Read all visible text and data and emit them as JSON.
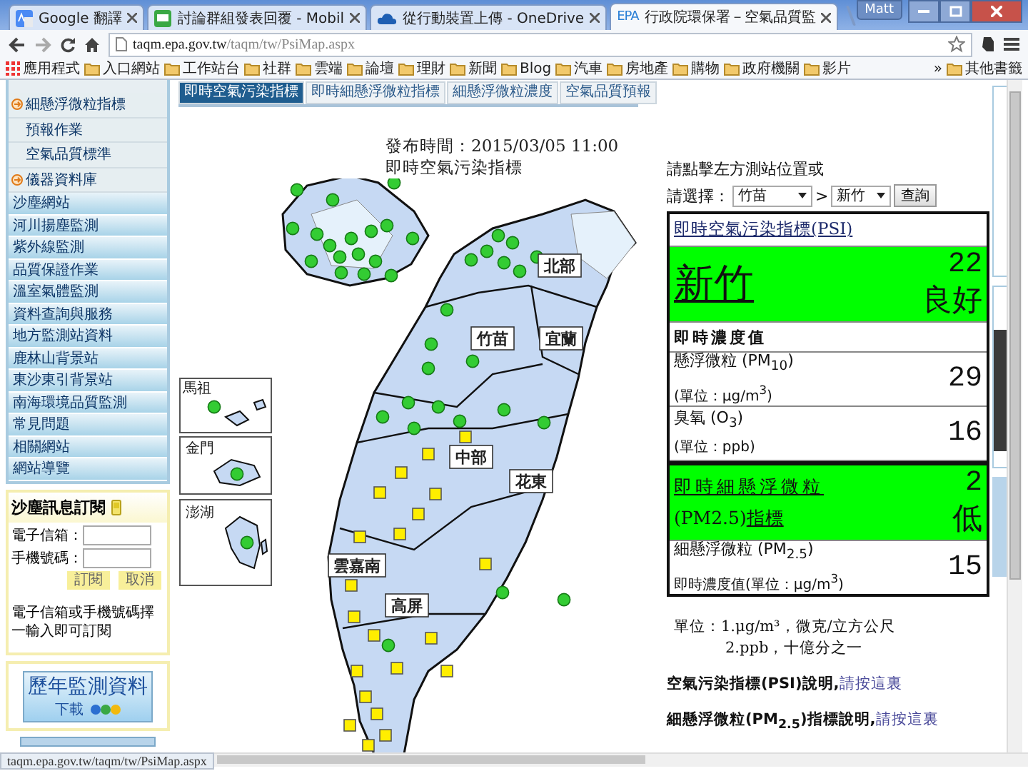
{
  "browser": {
    "tabs": [
      {
        "title": "Google 翻譯",
        "kind": "translate",
        "selected": false
      },
      {
        "title": "討論群組發表回覆 - Mobil",
        "kind": "group",
        "selected": false
      },
      {
        "title": "從行動裝置上傳 - OneDrive",
        "kind": "cloud",
        "selected": false
      },
      {
        "title": "行政院環保署－空氣品質監",
        "kind": "logo",
        "icon_text": "EPA",
        "selected": true
      }
    ],
    "user": "Matt",
    "url_host": "taqm.epa.gov.tw",
    "url_path": "/taqm/tw/PsiMap.aspx",
    "bookmarks": [
      {
        "label": "應用程式",
        "kind": "apps"
      },
      {
        "label": "入口網站",
        "kind": "folder"
      },
      {
        "label": "工作站台",
        "kind": "folder"
      },
      {
        "label": "社群",
        "kind": "folder"
      },
      {
        "label": "雲端",
        "kind": "folder"
      },
      {
        "label": "論壇",
        "kind": "folder"
      },
      {
        "label": "理財",
        "kind": "folder"
      },
      {
        "label": "新聞",
        "kind": "folder"
      },
      {
        "label": "Blog",
        "kind": "folder"
      },
      {
        "label": "汽車",
        "kind": "folder"
      },
      {
        "label": "房地產",
        "kind": "folder"
      },
      {
        "label": "購物",
        "kind": "folder"
      },
      {
        "label": "政府機關",
        "kind": "folder"
      },
      {
        "label": "影片",
        "kind": "folder"
      }
    ],
    "bookmarks_overflow": "»",
    "other_bookmarks": "其他書籤"
  },
  "sidebar": {
    "items": [
      {
        "label": "細懸浮微粒指標",
        "kind": "arrow"
      },
      {
        "label": "預報作業",
        "kind": "sub"
      },
      {
        "label": "空氣品質標準",
        "kind": "sub"
      },
      {
        "label": "儀器資料庫",
        "kind": "arrow"
      },
      {
        "label": "沙塵網站",
        "kind": "main"
      },
      {
        "label": "河川揚塵監測",
        "kind": "main"
      },
      {
        "label": "紫外線監測",
        "kind": "main"
      },
      {
        "label": "品質保證作業",
        "kind": "main"
      },
      {
        "label": "溫室氣體監測",
        "kind": "main"
      },
      {
        "label": "資料查詢與服務",
        "kind": "main"
      },
      {
        "label": "地方監測站資料",
        "kind": "main"
      },
      {
        "label": "鹿林山背景站",
        "kind": "main"
      },
      {
        "label": "東沙東引背景站",
        "kind": "main"
      },
      {
        "label": "南海環境品質監測",
        "kind": "main"
      },
      {
        "label": "常見問題",
        "kind": "main"
      },
      {
        "label": "相關網站",
        "kind": "main"
      },
      {
        "label": "網站導覽",
        "kind": "main"
      }
    ],
    "subscribe": {
      "title": "沙塵訊息訂閱",
      "email_label": "電子信箱：",
      "phone_label": "手機號碼：",
      "subscribe_button": "訂閱",
      "cancel_button": "取消",
      "note": "電子信箱或手機號碼擇一輸入即可訂閱"
    },
    "banner": {
      "title": "歷年監測資料",
      "subtitle": "下載"
    }
  },
  "tabs": [
    {
      "label": "即時空氣污染指標",
      "selected": true
    },
    {
      "label": "即時細懸浮微粒指標",
      "selected": false
    },
    {
      "label": "細懸浮微粒濃度",
      "selected": false
    },
    {
      "label": "空氣品質預報",
      "selected": false
    }
  ],
  "map": {
    "published": "發布時間：2015/03/05 11:00",
    "title": "即時空氣污染指標",
    "regions": [
      "北部",
      "竹苗",
      "宜蘭",
      "中部",
      "花東",
      "雲嘉南",
      "高屏"
    ],
    "insets": [
      "馬祖",
      "金門",
      "澎湖"
    ]
  },
  "panel": {
    "prompt": "請點擊左方測站位置或",
    "select_label": "請選擇：",
    "county": "竹苗",
    "separator": ">",
    "station": "新竹",
    "query_button": "查詢",
    "psi": {
      "heading": "即時空氣污染指標(PSI)",
      "station": "新竹",
      "value": "22",
      "status": "良好",
      "color": "#00ff00"
    },
    "concentration_heading": "即時濃度值",
    "readings": [
      {
        "name": "懸浮微粒 (PM$_{10}$)",
        "unit": "(單位：μg/m$^{3}$)",
        "value": "29"
      },
      {
        "name": "臭氧 (O$_{3}$)",
        "unit": "(單位：ppb)",
        "value": "16"
      }
    ],
    "pm25": {
      "heading_link": "即時細懸浮微粒",
      "heading_text": "(PM2.5)",
      "heading_link_2": "指標",
      "value": "2",
      "status": "低",
      "color": "#00ff00",
      "reading_name": "細懸浮微粒 (PM$_{2.5}$)",
      "reading_unit": "即時濃度值(單位：μg/m$^{3}$)",
      "reading_value": "15"
    },
    "units": [
      "單位：1.μg/m³，微克/立方公尺",
      "2.ppb，十億分之一"
    ],
    "notes": [
      {
        "text": "空氣污染指標(PSI)說明,",
        "link": "請按這裏"
      },
      {
        "text": "細懸浮微粒(PM$_{2.5}$)指標說明,",
        "link": "請按這裏"
      }
    ]
  },
  "status_bar": "taqm.epa.gov.tw/taqm/tw/PsiMap.aspx"
}
